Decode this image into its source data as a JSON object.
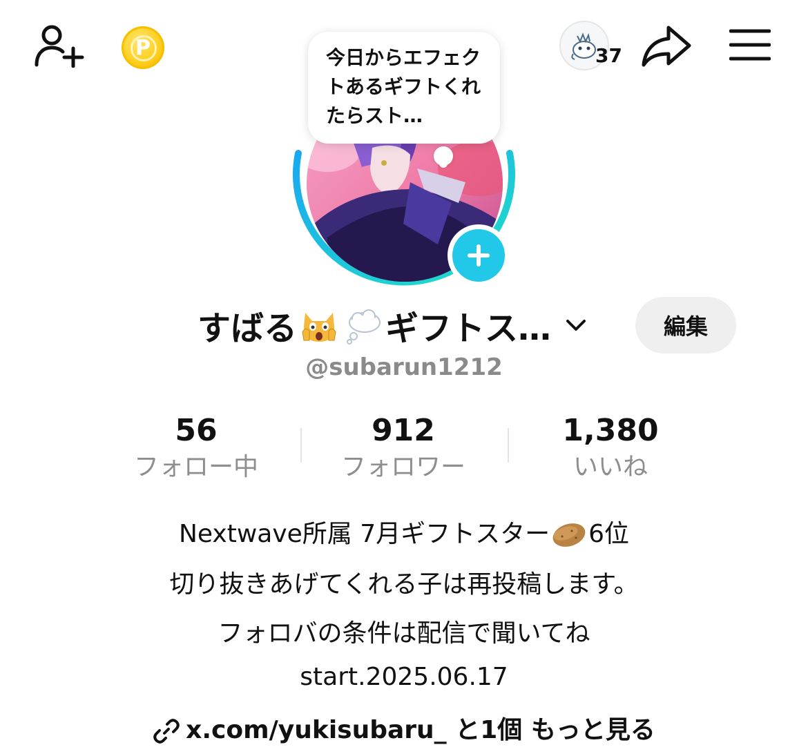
{
  "header": {
    "add_friend_icon": "person-add-icon",
    "coin_icon": "points-coin-icon",
    "coin_letter": "P",
    "visitor_count": "37",
    "share_icon": "share-arrow-icon",
    "menu_icon": "hamburger-menu-icon"
  },
  "profile": {
    "bubble_text": "今日からエフェクトあるギフトくれたらスト…",
    "display_name": "すばる",
    "display_name_rest": "ギフトス…",
    "name_emojis": [
      "scream-cat-emoji",
      "thought-balloon-emoji"
    ],
    "edit_label": "編集",
    "username": "@subarun1212"
  },
  "stats": {
    "following": {
      "value": "56",
      "label": "フォロー中"
    },
    "followers": {
      "value": "912",
      "label": "フォロワー"
    },
    "likes": {
      "value": "1,380",
      "label": "いいね"
    }
  },
  "bio": {
    "line1_prefix": "Nextwave所属 7月ギフトスター",
    "line1_suffix": "6位",
    "line2": "切り抜きあげてくれる子は再投稿します。",
    "line3": "フォロバの条件は配信で聞いてね",
    "line4": "start.2025.06.17"
  },
  "link": {
    "url_text": "x.com/yukisubaru_",
    "extra_text": "と1個",
    "more_text": "もっと見る"
  },
  "colors": {
    "accent_cyan": "#22c8e8",
    "ring_blue": "#1aa8f0",
    "ring_teal": "#20e0c8",
    "coin_gold": "#ffcf1f",
    "edit_button_bg": "#efefef",
    "muted_text": "#8a8a8a"
  }
}
